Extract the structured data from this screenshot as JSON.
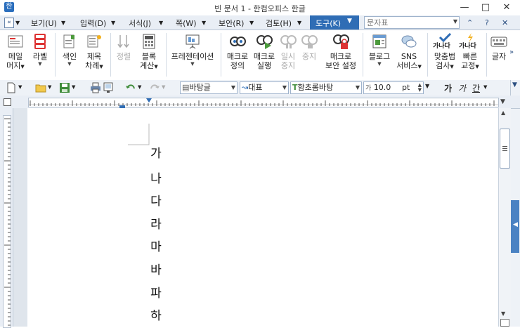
{
  "window": {
    "title": "빈 문서 1 - 한컴오피스 한글",
    "app_icon": "한"
  },
  "menu": {
    "items": [
      "보기(U)",
      "입력(D)",
      "서식(J)",
      "쪽(W)",
      "보안(R)",
      "검토(H)"
    ],
    "active": "도구(K)",
    "search_placeholder": "문자표"
  },
  "ribbon": {
    "buttons": [
      {
        "id": "mail-merge",
        "line1": "메일",
        "line2": "머지"
      },
      {
        "id": "label",
        "line1": "라벨",
        "line2": ""
      },
      {
        "id": "index",
        "line1": "색인",
        "line2": ""
      },
      {
        "id": "toc",
        "line1": "제목",
        "line2": "차례"
      },
      {
        "id": "sort",
        "line1": "정렬",
        "line2": ""
      },
      {
        "id": "block-calc",
        "line1": "블록",
        "line2": "계산"
      },
      {
        "id": "presentation",
        "line1": "프레젠테이션",
        "line2": ""
      },
      {
        "id": "macro-define",
        "line1": "매크로",
        "line2": "정의"
      },
      {
        "id": "macro-run",
        "line1": "매크로",
        "line2": "실행"
      },
      {
        "id": "pause",
        "line1": "일시",
        "line2": "중지"
      },
      {
        "id": "stop",
        "line1": "중지",
        "line2": ""
      },
      {
        "id": "macro-security",
        "line1": "매크로",
        "line2": "보안 설정"
      },
      {
        "id": "blog",
        "line1": "블로그",
        "line2": ""
      },
      {
        "id": "sns",
        "line1": "SNS",
        "line2": "서비스"
      },
      {
        "id": "spell",
        "line1": "맞춤법",
        "line2": "검사"
      },
      {
        "id": "quick-correct",
        "line1": "빠른",
        "line2": "교정"
      },
      {
        "id": "char-input",
        "line1": "글자",
        "line2": ""
      }
    ],
    "spell_icon_text": "가나다",
    "quick_icon_text": "가나다"
  },
  "toolbar": {
    "style": "바탕글",
    "lang": "대표",
    "font": "함초롬바탕",
    "size": "10.0",
    "unit": "pt",
    "bold_sample": "가",
    "italic_sample": "가",
    "underline_sample": "간"
  },
  "document": {
    "chars": [
      "가",
      "나",
      "다",
      "라",
      "마",
      "바",
      "파",
      "하"
    ]
  },
  "colors": {
    "accent": "#2f6db5",
    "ribbon_border": "#bcc8d6"
  }
}
